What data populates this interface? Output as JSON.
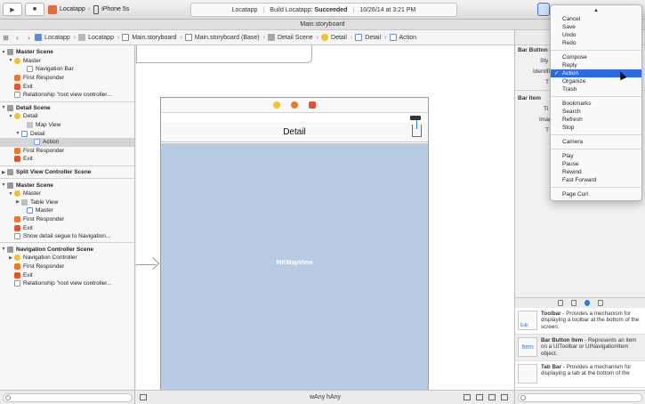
{
  "toolbar": {
    "run_icon": "play-icon",
    "stop_icon": "stop-icon",
    "scheme": "Locatapp",
    "device": "iPhone 5s",
    "activity": {
      "project": "Locatapp",
      "status_prefix": "Build Locatapp:",
      "status_value": "Succeeded",
      "timestamp": "10/26/14 at 3:21 PM"
    }
  },
  "file_title": "Main.storyboard",
  "jumpbar": {
    "crumbs": [
      "Locatapp",
      "Locatapp",
      "Main.storyboard",
      "Main.storyboard (Base)",
      "Detail Scene",
      "Detail",
      "Detail",
      "Action"
    ]
  },
  "outline": {
    "master_scene_1": {
      "header": "Master Scene",
      "vc": "Master",
      "navbar": "Navigation Bar",
      "fr": "First Responder",
      "exit": "Exit",
      "rel": "Relationship \"root view controller..."
    },
    "detail_scene": {
      "header": "Detail Scene",
      "vc": "Detail",
      "mapview": "Map View",
      "navitem": "Detail",
      "action": "Action",
      "fr": "First Responder",
      "exit": "Exit"
    },
    "split_scene": {
      "header": "Split View Controller Scene"
    },
    "master_scene_2": {
      "header": "Master Scene",
      "vc": "Master",
      "tableview": "Table View",
      "navitem": "Master",
      "fr": "First Responder",
      "exit": "Exit",
      "segue": "Show detail segue to Navigation..."
    },
    "nav_scene": {
      "header": "Navigation Controller Scene",
      "vc": "Navigation Controller",
      "fr": "First Responder",
      "exit": "Exit",
      "rel": "Relationship \"root view controller..."
    }
  },
  "canvas": {
    "nav_title": "Detail",
    "map_label": "MKMapView",
    "size_class": "wAny hAny"
  },
  "inspector": {
    "section_bbi": "Bar Button It",
    "row_style": "Sty",
    "row_identifier": "Identifi",
    "row_tint": "T",
    "section_bar_item": "Bar Item",
    "row_title": "Ti",
    "row_image": "Imag",
    "row_tag": "T"
  },
  "menu": {
    "items_group1": [
      "Cancel",
      "Save",
      "Undo",
      "Redo"
    ],
    "items_group2": [
      "Compose",
      "Reply",
      "Action",
      "Organize",
      "Trash"
    ],
    "selected": "Action",
    "items_group3": [
      "Bookmarks",
      "Search",
      "Refresh",
      "Stop"
    ],
    "items_group4": [
      "Camera"
    ],
    "items_group5": [
      "Play",
      "Pause",
      "Rewind",
      "Fast Forward"
    ],
    "items_group6": [
      "Page Curl"
    ]
  },
  "library": {
    "items": [
      {
        "title": "Toolbar",
        "desc": " - Provides a mechanism for displaying a toolbar at the bottom of the screen.",
        "thumb": "Edit"
      },
      {
        "title": "Bar Button Item",
        "desc": " - Represents an item on a UIToolbar or UINavigationItem object.",
        "thumb": "Item"
      },
      {
        "title": "Tab Bar",
        "desc": " - Provides a mechanism for displaying a tab at the bottom of the",
        "thumb": ""
      }
    ]
  },
  "colors": {
    "accent": "#2c6be0",
    "map": "#b8cbe4",
    "vc_icon": "#f2c12e",
    "exit_icon": "#e2542c"
  }
}
